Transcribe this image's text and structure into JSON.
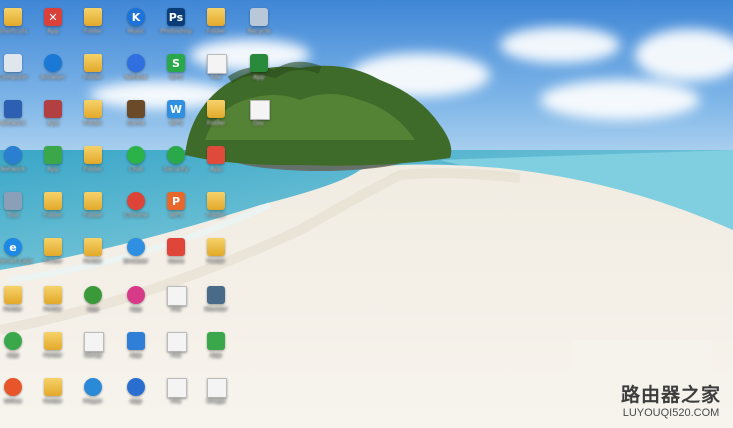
{
  "desktop": {
    "icons": [
      {
        "icon": "folder-icon",
        "color": "#e2a92a",
        "glyph": "",
        "label": "Shortcuts"
      },
      {
        "icon": "red-app-icon",
        "color": "#d9413a",
        "glyph": "✕",
        "label": "App"
      },
      {
        "icon": "folder-icon",
        "color": "#e2a92a",
        "glyph": "",
        "label": "Folder"
      },
      {
        "icon": "kugou-icon",
        "color": "#1e73d8",
        "glyph": "K",
        "label": "Music"
      },
      {
        "icon": "photoshop-icon",
        "color": "#0a3d78",
        "glyph": "Ps",
        "label": "Photoshop"
      },
      {
        "icon": "folder-icon",
        "color": "#e2a92a",
        "glyph": "",
        "label": "Folder"
      },
      {
        "icon": "recycle-bin-icon",
        "color": "#b8c8d8",
        "glyph": "",
        "label": "Recycle"
      },
      {
        "icon": "monitor-icon",
        "color": "#dfe6ee",
        "glyph": "",
        "label": "Computer"
      },
      {
        "icon": "blue-swirl-icon",
        "color": "#1a78d6",
        "glyph": "",
        "label": "Browser"
      },
      {
        "icon": "folder-icon",
        "color": "#e2a92a",
        "glyph": "",
        "label": "Folder"
      },
      {
        "icon": "baidu-icon",
        "color": "#2f6fe0",
        "glyph": "",
        "label": "Netdisk"
      },
      {
        "icon": "wps-s-icon",
        "color": "#29a84a",
        "glyph": "S",
        "label": "WPS"
      },
      {
        "icon": "blank-file-icon",
        "color": "#ffffff",
        "glyph": "",
        "label": "File"
      },
      {
        "icon": "arrow-app-icon",
        "color": "#2a8a3c",
        "glyph": "",
        "label": "App"
      },
      {
        "icon": "network-icon",
        "color": "#2d5fb3",
        "glyph": "",
        "label": "Network"
      },
      {
        "icon": "photo-app-icon",
        "color": "#b34040",
        "glyph": "",
        "label": "App"
      },
      {
        "icon": "folder-icon",
        "color": "#e2a92a",
        "glyph": "",
        "label": "Folder"
      },
      {
        "icon": "game-icon",
        "color": "#6b4a2a",
        "glyph": "",
        "label": "Game"
      },
      {
        "icon": "wps-w-icon",
        "color": "#2f8fe0",
        "glyph": "W",
        "label": "WPS"
      },
      {
        "icon": "folder-icon",
        "color": "#e2a92a",
        "glyph": "",
        "label": "Folder"
      },
      {
        "icon": "document-icon",
        "color": "#f4f4f4",
        "glyph": "",
        "label": "Doc"
      },
      {
        "icon": "globe-icon",
        "color": "#2a7fd0",
        "glyph": "",
        "label": "Network"
      },
      {
        "icon": "green-app-icon",
        "color": "#3aa84a",
        "glyph": "",
        "label": "App"
      },
      {
        "icon": "folder-icon",
        "color": "#e2a92a",
        "glyph": "",
        "label": "Folder"
      },
      {
        "icon": "wechat-icon",
        "color": "#2bb34a",
        "glyph": "",
        "label": "Chat"
      },
      {
        "icon": "shield-icon",
        "color": "#2aa84a",
        "glyph": "",
        "label": "Security"
      },
      {
        "icon": "colorful-app-icon",
        "color": "#e04a3a",
        "glyph": "",
        "label": "App"
      },
      {
        "icon": "tool-icon",
        "color": "#8aa0b8",
        "glyph": "",
        "label": "Tool"
      },
      {
        "icon": "folder-icon",
        "color": "#e2a92a",
        "glyph": "",
        "label": "Folder"
      },
      {
        "icon": "folder-icon",
        "color": "#e2a92a",
        "glyph": "",
        "label": "Folder"
      },
      {
        "icon": "chrome-icon",
        "color": "#db4437",
        "glyph": "",
        "label": "Chrome"
      },
      {
        "icon": "wps-p-icon",
        "color": "#e8672a",
        "glyph": "P",
        "label": "WPS"
      },
      {
        "icon": "folder-icon",
        "color": "#e2a92a",
        "glyph": "",
        "label": "Folder"
      },
      {
        "icon": "ie-icon",
        "color": "#1e88e5",
        "glyph": "e",
        "label": "Internet Explorer"
      },
      {
        "icon": "folder-icon",
        "color": "#e2a92a",
        "glyph": "",
        "label": "Folder"
      },
      {
        "icon": "folder-icon",
        "color": "#e2a92a",
        "glyph": "",
        "label": "Folder"
      },
      {
        "icon": "qq-browser-icon",
        "color": "#2f8fe0",
        "glyph": "",
        "label": "Browser"
      },
      {
        "icon": "app-store-icon",
        "color": "#e0453a",
        "glyph": "",
        "label": "Store"
      },
      {
        "icon": "folder-icon",
        "color": "#e2a92a",
        "glyph": "",
        "label": "Folder"
      },
      {
        "icon": "folder-icon",
        "color": "#e2a92a",
        "glyph": "",
        "label": "Folder"
      },
      {
        "icon": "folder-icon",
        "color": "#e2a92a",
        "glyph": "",
        "label": "Folder"
      },
      {
        "icon": "green-ball-icon",
        "color": "#3a9a3a",
        "glyph": "",
        "label": "App"
      },
      {
        "icon": "pink-app-icon",
        "color": "#d83a8a",
        "glyph": "",
        "label": "App"
      },
      {
        "icon": "text-file-icon",
        "color": "#f4f4f4",
        "glyph": "",
        "label": "File"
      },
      {
        "icon": "monitor-icon",
        "color": "#4a6a8a",
        "glyph": "",
        "label": "Monitor"
      },
      {
        "icon": "green-shield-icon",
        "color": "#3aa84a",
        "glyph": "",
        "label": "App"
      },
      {
        "icon": "folder-icon",
        "color": "#e2a92a",
        "glyph": "",
        "label": "Folder"
      },
      {
        "icon": "exe-file-icon",
        "color": "#f0f0f0",
        "glyph": "",
        "label": "Setup"
      },
      {
        "icon": "blue-check-icon",
        "color": "#2f7fd8",
        "glyph": "",
        "label": "App"
      },
      {
        "icon": "blank-file-icon",
        "color": "#f4f4f4",
        "glyph": "",
        "label": "File"
      },
      {
        "icon": "leaf-icon",
        "color": "#3aa84a",
        "glyph": "",
        "label": "App"
      },
      {
        "icon": "office-icon",
        "color": "#e8552a",
        "glyph": "",
        "label": "Office"
      },
      {
        "icon": "folder-icon",
        "color": "#e2a92a",
        "glyph": "",
        "label": "Folder"
      },
      {
        "icon": "media-icon",
        "color": "#2a8ad8",
        "glyph": "",
        "label": "Player"
      },
      {
        "icon": "swirl-app-icon",
        "color": "#2a6fd0",
        "glyph": "",
        "label": "App"
      },
      {
        "icon": "blank-file-icon",
        "color": "#f4f4f4",
        "glyph": "",
        "label": "File"
      },
      {
        "icon": "image-file-icon",
        "color": "#5aa84a",
        "glyph": "",
        "label": "Image"
      }
    ]
  },
  "watermark": {
    "title": "路由器之家",
    "url": "LUYOUQI520.COM"
  }
}
